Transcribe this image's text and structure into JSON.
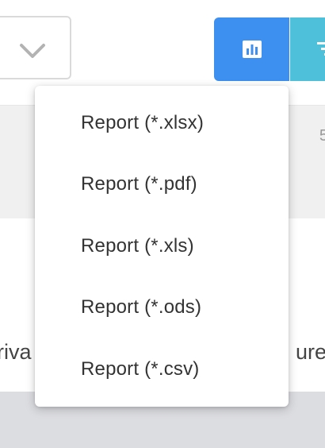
{
  "icons": {
    "dropdown_chevron": "chevron-down-icon",
    "report": "bar-chart-icon",
    "filter": "filter-icon"
  },
  "colors": {
    "report_button": "#3d8ff0",
    "filter_button": "#4ec0d9"
  },
  "table": {
    "row_number_partial": "5",
    "cell_left_partial": "riva",
    "cell_right_partial": "ure"
  },
  "export_menu": {
    "items": [
      {
        "label": "Report (*.xlsx)"
      },
      {
        "label": "Report (*.pdf)"
      },
      {
        "label": "Report (*.xls)"
      },
      {
        "label": "Report (*.ods)"
      },
      {
        "label": "Report (*.csv)"
      }
    ]
  }
}
